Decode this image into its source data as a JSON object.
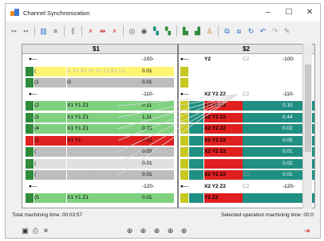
{
  "window": {
    "title": "Channel Synchronization",
    "min_icon": "minimize-icon",
    "max_icon": "maximize-icon",
    "close_icon": "close-icon"
  },
  "channels": {
    "left": "$1",
    "right": "$2"
  },
  "colors": {
    "green": "#7fd17f",
    "yellow": "#fff573",
    "red": "#e02020",
    "teal": "#1f8f82",
    "darkgreen": "#2e8b3a",
    "gray": "#bdbdbd",
    "lightgray": "#e0e0e0",
    "white": "#ffffff"
  },
  "rows": [
    {
      "left": {
        "axes": "",
        "val": "-100-",
        "bg": "white",
        "arrow": true
      },
      "right": {
        "axes": "Y2",
        "c": "C2",
        "val": "-100-",
        "bg": "white",
        "arrow": true
      }
    },
    {
      "left": {
        "name": "(",
        "axes": "G X1 X2 Y1 Y2 Z1 B1 C1",
        "val": "0.01",
        "bg": "yellow"
      },
      "right": {
        "axes": "",
        "c": "",
        "val": "",
        "bg": "white"
      }
    },
    {
      "left": {
        "name": "(1",
        "axes": "G",
        "val": "0.01",
        "bg": "gray"
      },
      "right": {
        "axes": "",
        "c": "",
        "val": "",
        "bg": "white"
      }
    },
    {
      "left": {
        "axes": "",
        "val": "-110-",
        "bg": "white",
        "arrow": true
      },
      "right": {
        "axes": "X2 Y2 Z2",
        "c": "C2",
        "val": "-110-",
        "bg": "white",
        "arrow": true
      }
    },
    {
      "left": {
        "name": "(2",
        "axes": "X1 Y1 Z1",
        "val": "0.11",
        "bg": "green"
      },
      "right": {
        "axes": "X2 Y2 Z2",
        "c": "",
        "val": "0.10",
        "bg": "teal"
      }
    },
    {
      "left": {
        "name": "(3",
        "axes": "X1 Y1 Z1",
        "val": "1.11",
        "bg": "green"
      },
      "right": {
        "axes": "X2 Y2 Z2",
        "c": "",
        "val": "0.44",
        "bg": "teal"
      }
    },
    {
      "left": {
        "name": "(4",
        "axes": "X1 Y1 Z1",
        "val": "0.23",
        "bg": "green"
      },
      "right": {
        "axes": "X2 Y2 Z2",
        "c": "",
        "val": "0.02",
        "bg": "teal"
      }
    },
    {
      "left": {
        "name": "(1",
        "axes": "X1 Y1",
        "val": "0.12",
        "bg": "red"
      },
      "right": {
        "axes": "X2 Y2 Z2",
        "c": "",
        "val": "0.05",
        "bg": "teal"
      }
    },
    {
      "left": {
        "name": "(",
        "axes": "",
        "val": "0.02",
        "bg": "gray"
      },
      "right": {
        "axes": "X2 Y2 Z2",
        "c": "",
        "val": "0.01",
        "bg": "teal"
      }
    },
    {
      "left": {
        "name": "(",
        "axes": "",
        "val": "0.01",
        "bg": "lightgray"
      },
      "right": {
        "axes": "",
        "c": "",
        "val": "0.02",
        "bg": "teal"
      }
    },
    {
      "left": {
        "name": "(",
        "axes": "G X1 Y1 Z1",
        "val": "0.01",
        "bg": "gray"
      },
      "right": {
        "axes": "X2 Y2 Z2",
        "c": "C2",
        "val": "0.01",
        "bg": "teal"
      }
    },
    {
      "left": {
        "axes": "",
        "val": "-120-",
        "bg": "white",
        "arrow": true
      },
      "right": {
        "axes": "X2 Y2 Z2",
        "c": "C2",
        "val": "-120-",
        "bg": "white",
        "arrow": true
      }
    },
    {
      "left": {
        "name": "(5",
        "axes": "X1 Y1 Z1",
        "val": "0.01",
        "bg": "green"
      },
      "right": {
        "axes": "Y2 Z2",
        "c": "",
        "val": "",
        "bg": "teal"
      }
    }
  ],
  "status": {
    "total": "Total machining time: 00:03:57",
    "selected": "Selected operation machining time: 00:0"
  },
  "zoom_icons": [
    "zoom-in-icon",
    "zoom-out-icon",
    "zoom-fit-icon",
    "zoom-reset-icon",
    "zoom-area-icon"
  ]
}
